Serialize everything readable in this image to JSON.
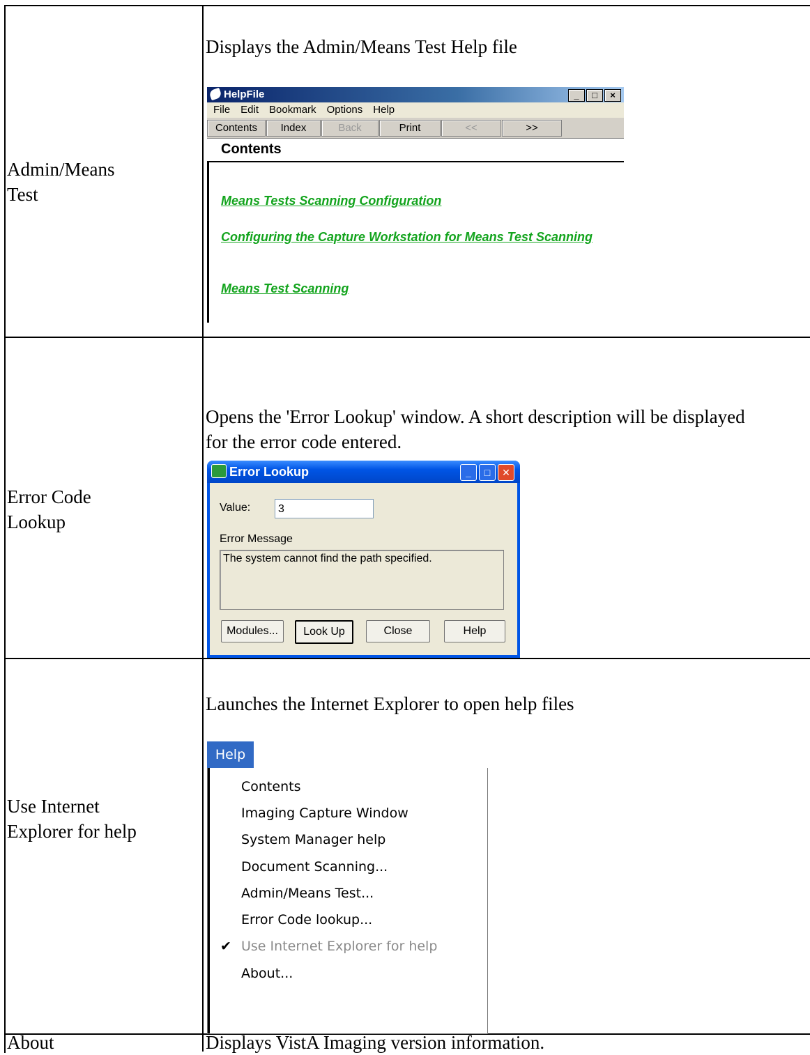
{
  "rows": [
    {
      "label": "Admin/Means Test",
      "desc": "Displays the Admin/Means Test Help file"
    },
    {
      "label": "Error Code Lookup",
      "desc": "Opens the 'Error Lookup' window. A short description will be displayed for the error code entered."
    },
    {
      "label": "Use Internet Explorer for help",
      "desc": "Launches the Internet Explorer to open help files"
    },
    {
      "label": "About",
      "desc": "Displays VistA Imaging version information."
    }
  ],
  "helpfile": {
    "title": "HelpFile",
    "menu": [
      "File",
      "Edit",
      "Bookmark",
      "Options",
      "Help"
    ],
    "toolbar": [
      "Contents",
      "Index",
      "Back",
      "Print",
      "<<",
      ">>"
    ],
    "heading": "Contents",
    "links": [
      "Means Tests Scanning Configuration",
      "Configuring the Capture Workstation for Means Test Scanning",
      "Means Test Scanning"
    ],
    "link_color": "#13a41d"
  },
  "error_lookup": {
    "title": "Error Lookup",
    "value_label": "Value:",
    "value": "3",
    "message_label": "Error Message",
    "message": "The system cannot find the path specified.",
    "buttons": [
      "Modules...",
      "Look Up",
      "Close",
      "Help"
    ]
  },
  "help_menu": {
    "title": "Help",
    "items": [
      "Contents",
      "Imaging Capture Window",
      "System Manager help",
      "Document Scanning...",
      "Admin/Means Test...",
      "Error Code lookup...",
      "Use Internet Explorer for help",
      "About..."
    ],
    "checked_item": "Use Internet Explorer for help"
  }
}
